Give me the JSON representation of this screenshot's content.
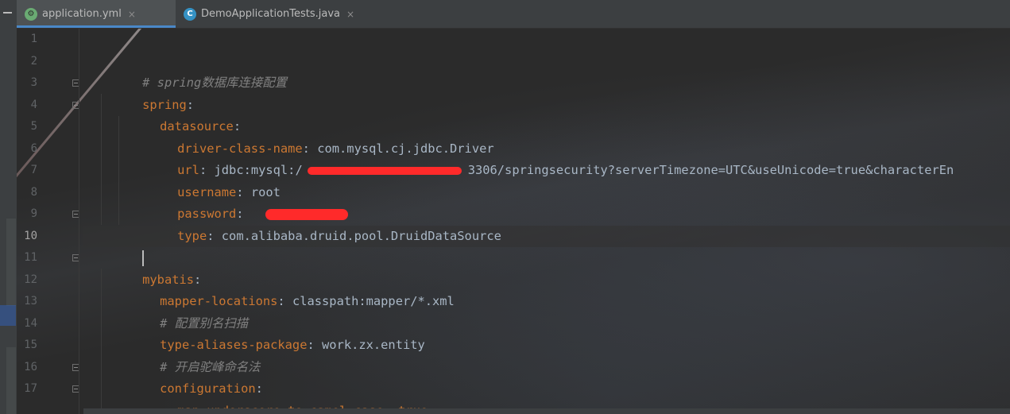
{
  "tabs": [
    {
      "label": "application.yml",
      "icon": "spring-leaf-icon",
      "active": true
    },
    {
      "label": "DemoApplicationTests.java",
      "icon": "java-class-icon",
      "active": false
    }
  ],
  "tab_close_glyph": "×",
  "gutter": {
    "line_numbers": [
      "1",
      "2",
      "3",
      "4",
      "5",
      "6",
      "7",
      "8",
      "9",
      "10",
      "11",
      "12",
      "13",
      "14",
      "15",
      "16",
      "17"
    ],
    "current_line": "10"
  },
  "code": {
    "comment_spring": "# spring数据库连接配置",
    "spring_key": "spring",
    "datasource_key": "datasource",
    "driver_key": "driver-class-name",
    "driver_value": "com.mysql.cj.jdbc.Driver",
    "url_key": "url",
    "url_prefix": "jdbc:mysql:/",
    "url_suffix": "3306/springsecurity?serverTimezone=UTC&useUnicode=true&characterEn",
    "username_key": "username",
    "username_value": "root",
    "password_key": "password",
    "type_key": "type",
    "type_value": "com.alibaba.druid.pool.DruidDataSource",
    "mybatis_key": "mybatis",
    "mapper_key": "mapper-locations",
    "mapper_value": "classpath:mapper/*.xml",
    "comment_alias": "# 配置别名扫描",
    "alias_key": "type-aliases-package",
    "alias_value": "work.zx.entity",
    "comment_camel": "# 开启驼峰命名法",
    "configuration_key": "configuration",
    "camel_key": "map-underscore-to-camel-case",
    "camel_value": "true",
    "colon": ":"
  },
  "colors": {
    "keyword": "#cc7832",
    "value": "#a9b7c6",
    "comment": "#808080",
    "redaction": "#ff2a2a",
    "active_tab_underline": "#4a88c7"
  }
}
